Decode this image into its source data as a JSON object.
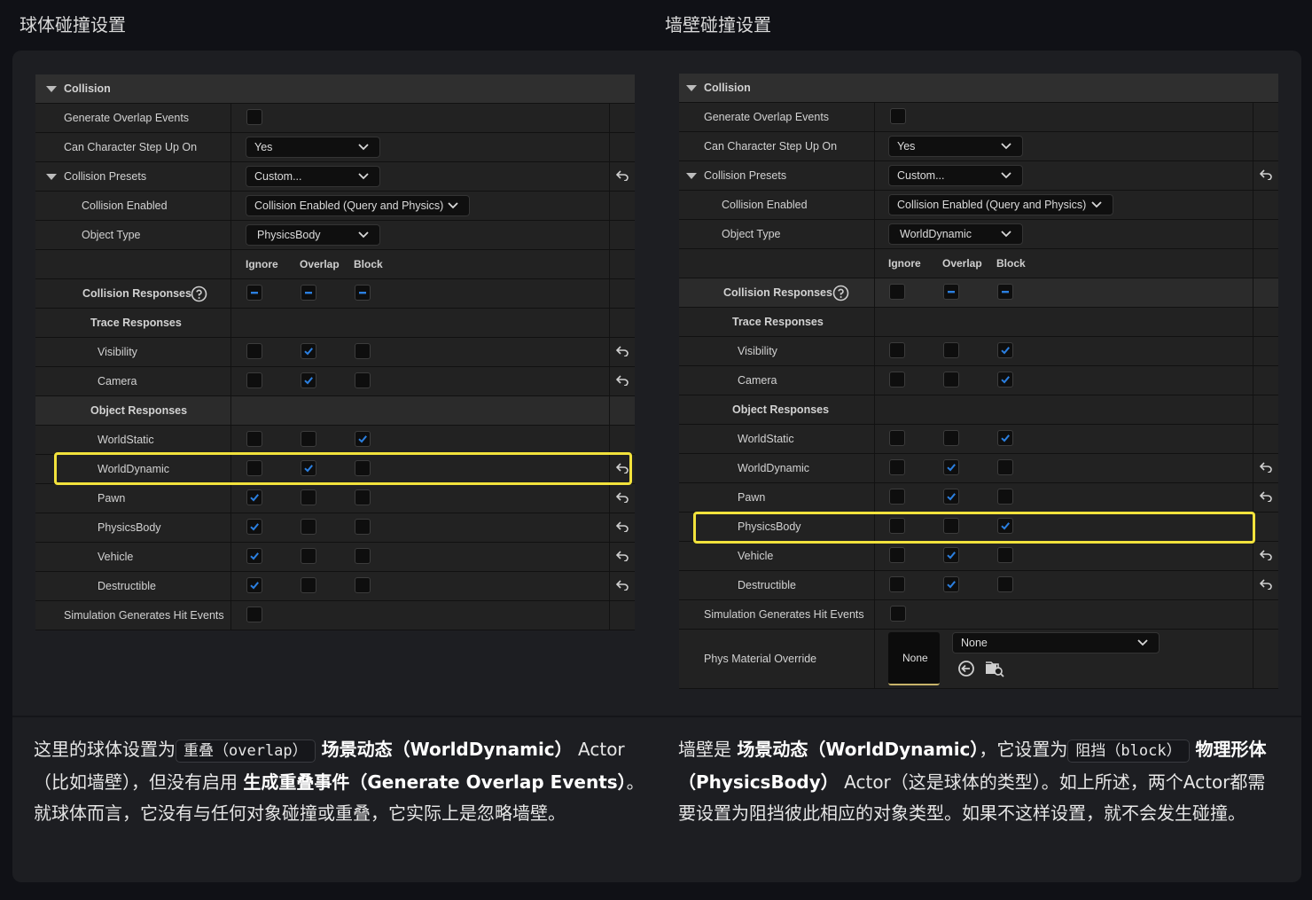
{
  "left_heading": "球体碰撞设置",
  "right_heading": "墙壁碰撞设置",
  "colors": {
    "accent_highlight": "#f2e23c",
    "check_blue": "#2b7fe0"
  },
  "left_panel": {
    "section": "Collision",
    "generate_overlap": "Generate Overlap Events",
    "step_up": "Can Character Step Up On",
    "step_up_value": "Yes",
    "presets": "Collision Presets",
    "presets_value": "Custom...",
    "enabled": "Collision Enabled",
    "enabled_value": "Collision Enabled (Query and Physics)",
    "object_type": "Object Type",
    "object_type_value": "PhysicsBody",
    "col_ignore": "Ignore",
    "col_overlap": "Overlap",
    "col_block": "Block",
    "responses": "Collision Responses",
    "trace": "Trace Responses",
    "visibility": "Visibility",
    "camera": "Camera",
    "object_responses": "Object Responses",
    "world_static": "WorldStatic",
    "world_dynamic": "WorldDynamic",
    "pawn": "Pawn",
    "physics_body": "PhysicsBody",
    "vehicle": "Vehicle",
    "destructible": "Destructible",
    "sim_hit": "Simulation Generates Hit Events"
  },
  "right_panel": {
    "section": "Collision",
    "generate_overlap": "Generate Overlap Events",
    "step_up": "Can Character Step Up On",
    "step_up_value": "Yes",
    "presets": "Collision Presets",
    "presets_value": "Custom...",
    "enabled": "Collision Enabled",
    "enabled_value": "Collision Enabled (Query and Physics)",
    "object_type": "Object Type",
    "object_type_value": "WorldDynamic",
    "col_ignore": "Ignore",
    "col_overlap": "Overlap",
    "col_block": "Block",
    "responses": "Collision Responses",
    "trace": "Trace Responses",
    "visibility": "Visibility",
    "camera": "Camera",
    "object_responses": "Object Responses",
    "world_static": "WorldStatic",
    "world_dynamic": "WorldDynamic",
    "pawn": "Pawn",
    "physics_body": "PhysicsBody",
    "vehicle": "Vehicle",
    "destructible": "Destructible",
    "sim_hit": "Simulation Generates Hit Events",
    "phys_material": "Phys Material Override",
    "thumb_label": "None",
    "material_value": "None"
  },
  "left_text": {
    "p1": "这里的球体设置为",
    "code": "重叠（overlap）",
    "p2": " 场景动态（WorldDynamic）",
    "p3": "Actor（比如墙壁），但没有启用 ",
    "p4": "生成重叠事件（Generate Overlap Events）",
    "p5": "。就球体而言，它没有与任何对象碰撞或重叠，它实际上是忽略墙壁。"
  },
  "right_text": {
    "p1": "墙壁是 ",
    "p2": "场景动态（WorldDynamic）",
    "p3": "，它设置为",
    "code": "阻挡（block）",
    "p4": " 物理形体（PhysicsBody）",
    "p5": "Actor（这是球体的类型）。如上所述，两个Actor都需要设置为阻挡彼此相应的对象类型。如果不这样设置，就不会发生碰撞。"
  }
}
